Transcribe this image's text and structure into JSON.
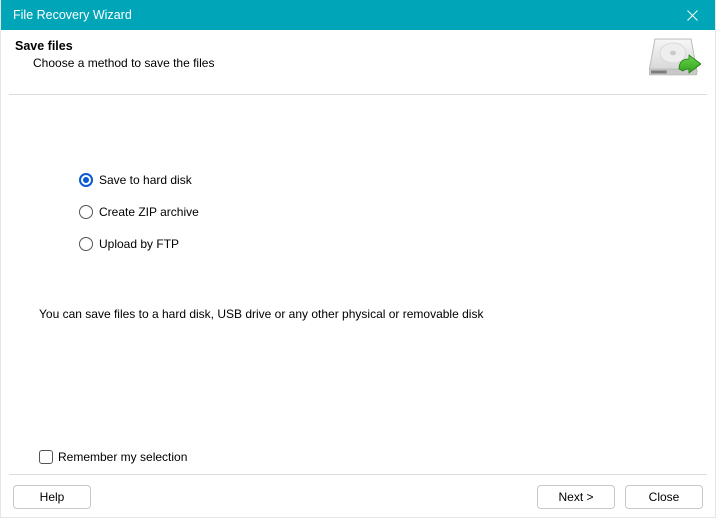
{
  "window": {
    "title": "File Recovery Wizard"
  },
  "header": {
    "heading": "Save files",
    "subtitle": "Choose a method to save the files"
  },
  "options": [
    {
      "label": "Save to hard disk",
      "selected": true
    },
    {
      "label": "Create ZIP archive",
      "selected": false
    },
    {
      "label": "Upload by FTP",
      "selected": false
    }
  ],
  "description": "You can save files to a hard disk, USB drive or any other physical or removable disk",
  "remember": {
    "label": "Remember my selection",
    "checked": false
  },
  "buttons": {
    "help": "Help",
    "next": "Next >",
    "close": "Close"
  }
}
